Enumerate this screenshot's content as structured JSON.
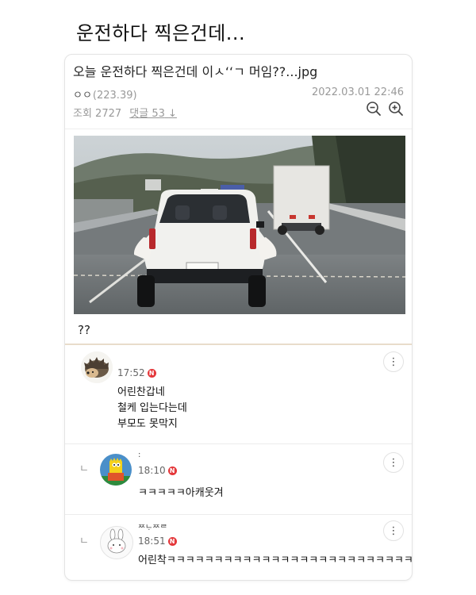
{
  "page": {
    "title": "운전하다 찍은건데..."
  },
  "post": {
    "title": "오늘 운전하다 찍은건데 이ㅅ‘‘ㄱ 머임??...jpg",
    "author": "ㅇㅇ",
    "author_ip": "(223.39)",
    "date": "2022.03.01 22:46",
    "views_label": "조회 2727",
    "comments_label": "댓글 53",
    "body": "??"
  },
  "icons": {
    "zoom_out": "zoom-out-icon",
    "zoom_in": "zoom-in-icon",
    "more": "more-vertical-icon",
    "reply": "reply-arrow-icon",
    "new_badge": "new-badge-icon"
  },
  "comments": [
    {
      "time": "17:52",
      "badge": "N",
      "lines": [
        "어린찬갑네",
        "철케 입는다는데",
        "부모도 못막지"
      ]
    },
    {
      "author": ":",
      "time": "18:10",
      "badge": "N",
      "reply_mark": "ㄴ",
      "lines": [
        "ㅋㅋㅋㅋㅋ아캐웃겨"
      ]
    },
    {
      "author": "ᄍᄂᆞᄍᄅ",
      "time": "18:51",
      "badge": "N",
      "reply_mark": "ㄴ",
      "lines": [
        "어린착ㅋㅋㅋㅋㅋㅋㅋㅋㅋㅋㅋㅋㅋㅋㅋㅋㅋㅋㅋㅋㅋㅋㅋㅋㅋㅋㅋㅋㅋㅋㅋ"
      ]
    }
  ],
  "colors": {
    "badge": "#e4373a",
    "divider_accent": "#e9dccb",
    "muted_text": "#999999"
  }
}
